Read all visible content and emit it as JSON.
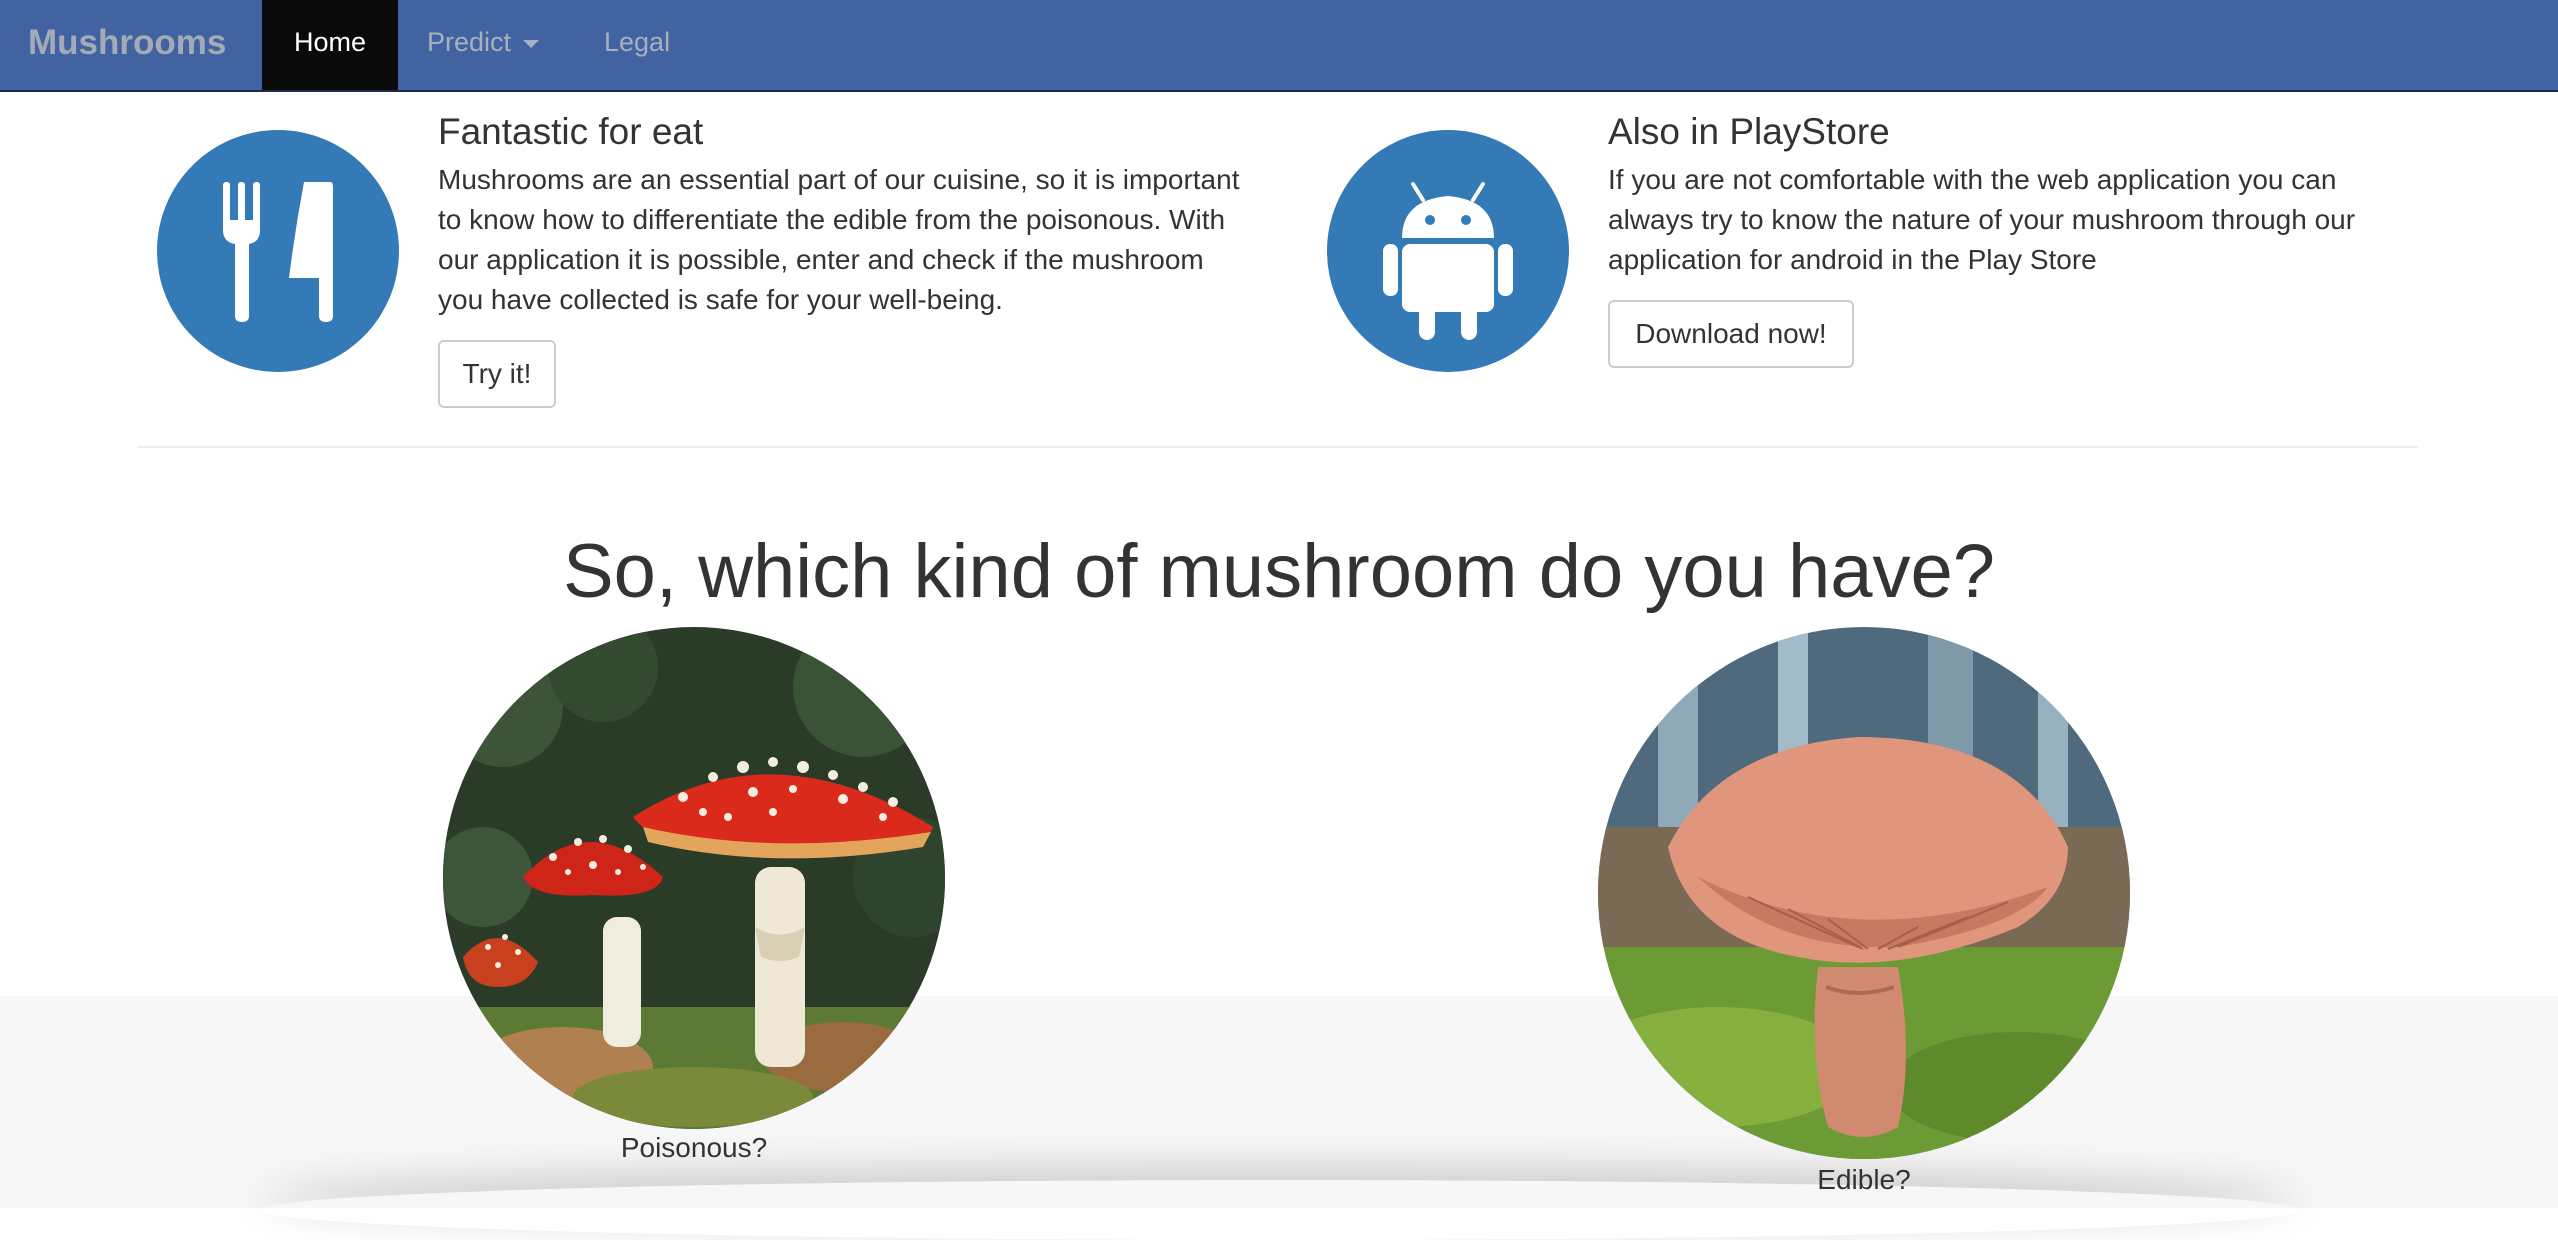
{
  "navbar": {
    "brand": "Mushrooms",
    "items": [
      {
        "label": "Home",
        "active": true
      },
      {
        "label": "Predict",
        "has_dropdown": true
      },
      {
        "label": "Legal"
      }
    ],
    "background_color": "#4263a1"
  },
  "features": [
    {
      "icon": "cutlery-icon",
      "title": "Fantastic for eat",
      "lines": [
        "Mushrooms are an essential part of our cuisine, so it is important",
        "to know how to differentiate the edible from the poisonous. With",
        "our application it is possible, enter and check if the mushroom",
        "you have collected is safe for your well-being."
      ],
      "button_label": "Try it!"
    },
    {
      "icon": "android-icon",
      "title": "Also in PlayStore",
      "lines": [
        "If you are not comfortable with the web application you can",
        "always try to know the nature of your mushroom through our",
        "application for android in the Play Store"
      ],
      "button_label": "Download now!"
    }
  ],
  "icon_circle_color": "#337ab7",
  "section": {
    "heading": "So, which kind of mushroom do you have?"
  },
  "choices": [
    {
      "caption": "Poisonous?",
      "image": "red-fly-agaric-mushroom-image"
    },
    {
      "caption": "Edible?",
      "image": "brown-edible-mushroom-image"
    }
  ]
}
